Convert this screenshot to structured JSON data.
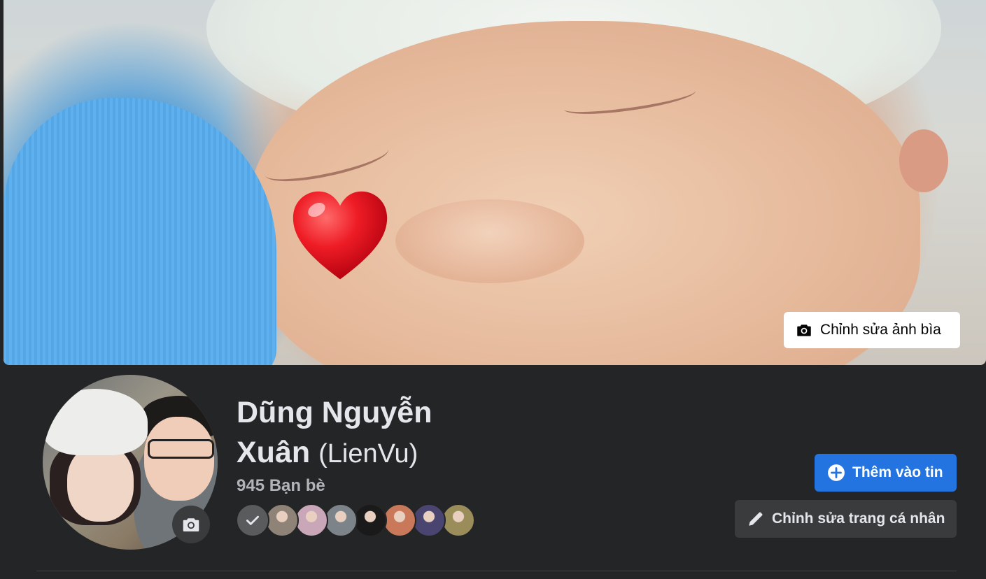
{
  "cover": {
    "edit_label": "Chỉnh sửa ảnh bìa",
    "heart_icon": "heart-emoji"
  },
  "profile": {
    "name_line1": "Dũng Nguyễn",
    "name_line2": "Xuân",
    "alternate_name": "(LienVu)",
    "friend_count": "945 Bạn bè",
    "friends_avatars": [
      {
        "kind": "mutual-check",
        "color": "#5a5b5c"
      },
      {
        "kind": "photo",
        "color": "#8e8376"
      },
      {
        "kind": "photo",
        "color": "#c9a7b9"
      },
      {
        "kind": "photo",
        "color": "#7d8489"
      },
      {
        "kind": "photo",
        "color": "#1a1a1a"
      },
      {
        "kind": "photo",
        "color": "#c9795a"
      },
      {
        "kind": "photo",
        "color": "#4a4570"
      },
      {
        "kind": "photo",
        "color": "#9a8d5a"
      }
    ]
  },
  "actions": {
    "add_story_label": "Thêm vào tin",
    "edit_profile_label": "Chỉnh sửa trang cá nhân"
  },
  "colors": {
    "background": "#242526",
    "primary_button": "#2374e1",
    "secondary_button": "#3a3b3c",
    "text_primary": "#e4e6eb",
    "text_secondary": "#b0b3b8"
  }
}
